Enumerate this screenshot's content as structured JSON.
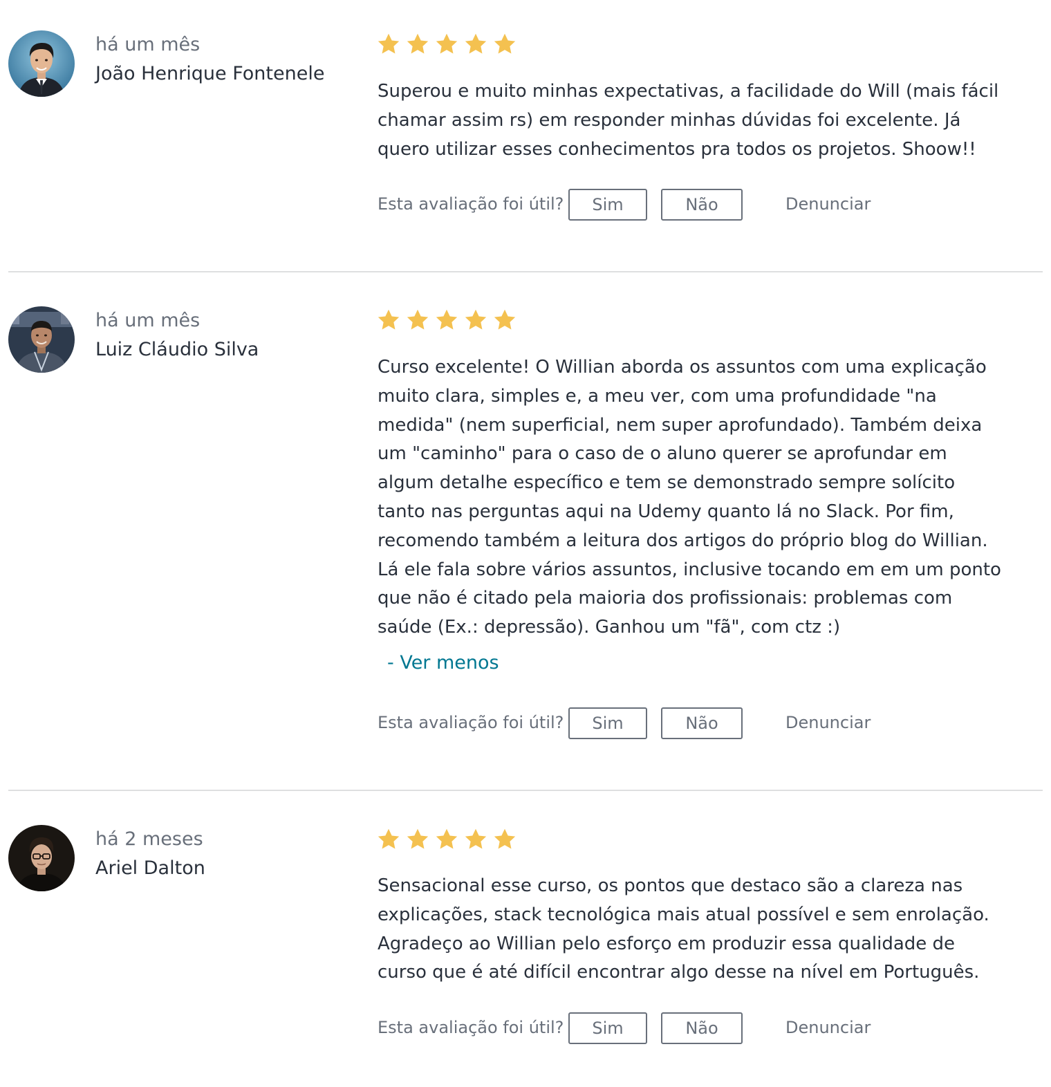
{
  "colors": {
    "star": "#f4c150",
    "link": "#007791",
    "muted": "#686f7a",
    "text": "#29303b",
    "divider": "#dedfe0"
  },
  "helpful_prompt": "Esta avaliação foi útil?",
  "yes_label": "Sim",
  "no_label": "Não",
  "report_label": "Denunciar",
  "reviews": [
    {
      "time": "há um mês",
      "author": "João Henrique Fontenele",
      "rating": 5,
      "lines": [
        "Superou e muito minhas expectativas, a facilidade do Will (mais fácil",
        "chamar assim rs) em responder minhas dúvidas foi excelente. Já",
        "quero utilizar esses conhecimentos pra todos os projetos. Shoow!!"
      ]
    },
    {
      "time": "há um mês",
      "author": "Luiz Cláudio Silva",
      "rating": 5,
      "lines": [
        "Curso excelente! O Willian aborda os assuntos com uma explicação",
        "muito clara, simples e, a meu ver, com uma profundidade \"na",
        "medida\" (nem superficial, nem super aprofundado). Também deixa",
        "um \"caminho\" para o caso de o aluno querer se aprofundar em",
        "algum detalhe específico e tem se demonstrado sempre solícito",
        "tanto nas perguntas aqui na Udemy quanto lá no Slack. Por fim,",
        "recomendo também a leitura dos artigos do próprio blog do Willian.",
        "Lá ele fala sobre vários assuntos, inclusive tocando em em um ponto",
        "que não é citado pela maioria dos profissionais: problemas com",
        "saúde (Ex.: depressão). Ganhou um \"fã\", com ctz :)"
      ],
      "toggle": "- Ver menos"
    },
    {
      "time": "há 2 meses",
      "author": "Ariel Dalton",
      "rating": 5,
      "lines": [
        "Sensacional esse curso, os pontos que destaco são a clareza nas",
        "explicações, stack tecnológica mais atual possível e sem enrolação.",
        "Agradeço ao Willian pelo esforço em produzir essa qualidade de",
        "curso que é até difícil encontrar algo desse na nível em Português."
      ]
    }
  ]
}
